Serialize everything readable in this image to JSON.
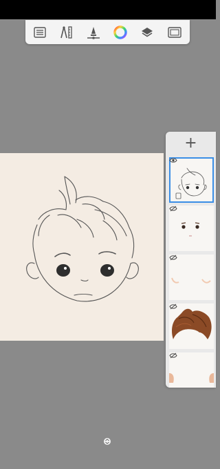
{
  "app": {
    "toolbar": {
      "tools": [
        {
          "name": "list-icon"
        },
        {
          "name": "ruler-compass-icon"
        },
        {
          "name": "brush-size-icon"
        },
        {
          "name": "color-wheel-icon"
        },
        {
          "name": "layers-icon"
        },
        {
          "name": "frame-icon"
        }
      ]
    },
    "layers_panel": {
      "add_label": "+",
      "layers": [
        {
          "name": "line-art",
          "visibility_icon": "eye-icon",
          "selected": true
        },
        {
          "name": "facial-features",
          "visibility_icon": "eye-hidden-icon",
          "selected": false
        },
        {
          "name": "blush",
          "visibility_icon": "eye-hidden-icon",
          "selected": false
        },
        {
          "name": "hair-color",
          "visibility_icon": "eye-hidden-icon",
          "selected": false
        },
        {
          "name": "skin-ears",
          "visibility_icon": "eye-hidden-icon",
          "selected": false
        }
      ]
    },
    "colors": {
      "workspace": "#8a8a8a",
      "canvas": "#f4ece3",
      "toolbar": "#f4f4f4",
      "selected_layer": "#3a8ee6",
      "hair": "#8b4a26"
    }
  }
}
